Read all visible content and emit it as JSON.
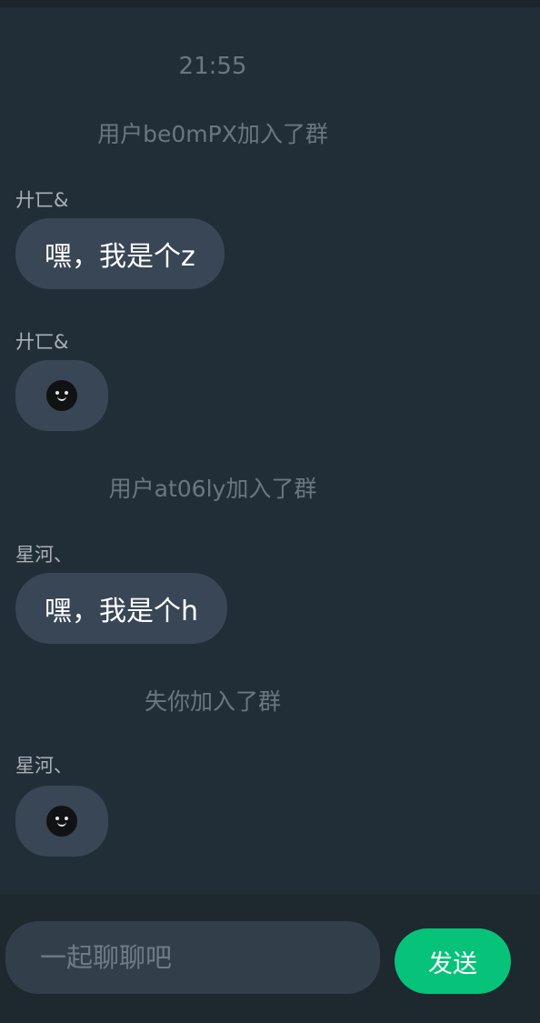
{
  "chat": {
    "timestamp": "21:55",
    "messages": [
      {
        "type": "system",
        "text": "用户be0mPX加入了群"
      },
      {
        "type": "text",
        "sender": "廾匸&",
        "text": "嘿，我是个z"
      },
      {
        "type": "sticker",
        "sender": "廾匸&",
        "icon": "smiley-face-icon"
      },
      {
        "type": "system",
        "text": "用户at06ly加入了群"
      },
      {
        "type": "text",
        "sender": "星河、",
        "text": "嘿，我是个h"
      },
      {
        "type": "system",
        "text": "失你加入了群"
      },
      {
        "type": "sticker",
        "sender": "星河、",
        "icon": "smiley-face-icon"
      }
    ]
  },
  "composer": {
    "placeholder": "一起聊聊吧",
    "value": "",
    "send_label": "发送"
  },
  "colors": {
    "background": "#222e37",
    "bubble": "#384655",
    "send_button": "#07c37a",
    "system_text": "#6b7780"
  }
}
